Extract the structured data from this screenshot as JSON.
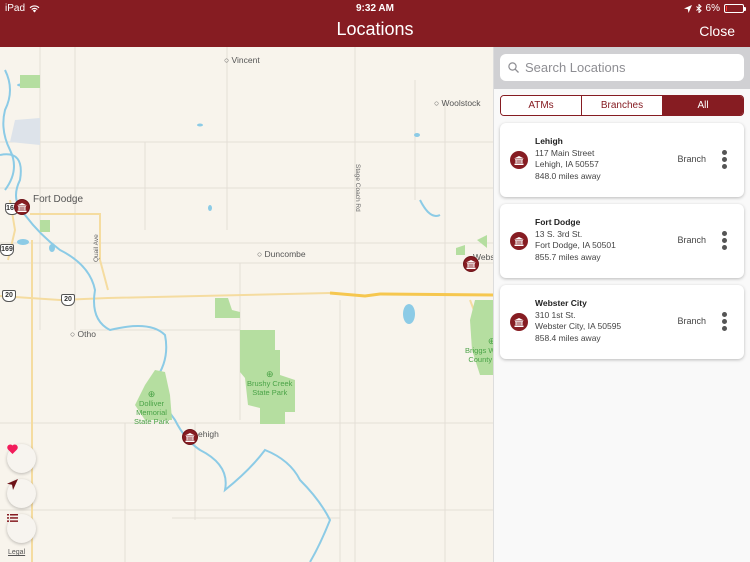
{
  "status_bar": {
    "device": "iPad",
    "time": "9:32 AM",
    "battery": "6%",
    "battery_level": 0.06
  },
  "nav": {
    "title": "Locations",
    "close_label": "Close"
  },
  "map": {
    "place_labels": {
      "vincent": "Vincent",
      "woolstock": "Woolstock",
      "fort_dodge": "Fort Dodge",
      "duncombe": "Duncombe",
      "webster": "Webs",
      "otho": "Otho",
      "lehigh": "ehigh"
    },
    "road_labels": {
      "quail_ave": "Quail Ave",
      "stage_coach_rd": "Stage Coach Rd"
    },
    "route_shields": {
      "us169_a": "169",
      "us169_b": "169",
      "us20_a": "20",
      "us20_b": "20"
    },
    "park_labels": {
      "brushy_creek": "Brushy Creek\nState Park",
      "dolliver": "Dolliver\nMemorial\nState Park",
      "briggs": "Briggs W\nCounty"
    },
    "legal_label": "Legal",
    "controls": [
      {
        "name": "favorites",
        "icon": "heart-icon"
      },
      {
        "name": "locate-me",
        "icon": "location-arrow-icon"
      },
      {
        "name": "list-view",
        "icon": "list-icon"
      }
    ]
  },
  "panel": {
    "search": {
      "placeholder": "Search Locations",
      "value": ""
    },
    "filters": [
      {
        "label": "ATMs",
        "active": false
      },
      {
        "label": "Branches",
        "active": false
      },
      {
        "label": "All",
        "active": true
      }
    ],
    "locations": [
      {
        "name": "Lehigh",
        "address": "117 Main Street",
        "city": "Lehigh, IA 50557",
        "distance": "848.0 miles away",
        "type": "Branch"
      },
      {
        "name": "Fort Dodge",
        "address": "13 S. 3rd St.",
        "city": "Fort Dodge, IA 50501",
        "distance": "855.7 miles away",
        "type": "Branch"
      },
      {
        "name": "Webster City",
        "address": "310 1st St.",
        "city": "Webster City, IA 50595",
        "distance": "858.4 miles away",
        "type": "Branch"
      }
    ]
  },
  "colors": {
    "brand": "#861c22",
    "map_bg": "#f8f4ec",
    "water": "#8ccbe6",
    "park": "#b5dea0",
    "highway": "#f6c74f",
    "favorite": "#f21c5b"
  }
}
